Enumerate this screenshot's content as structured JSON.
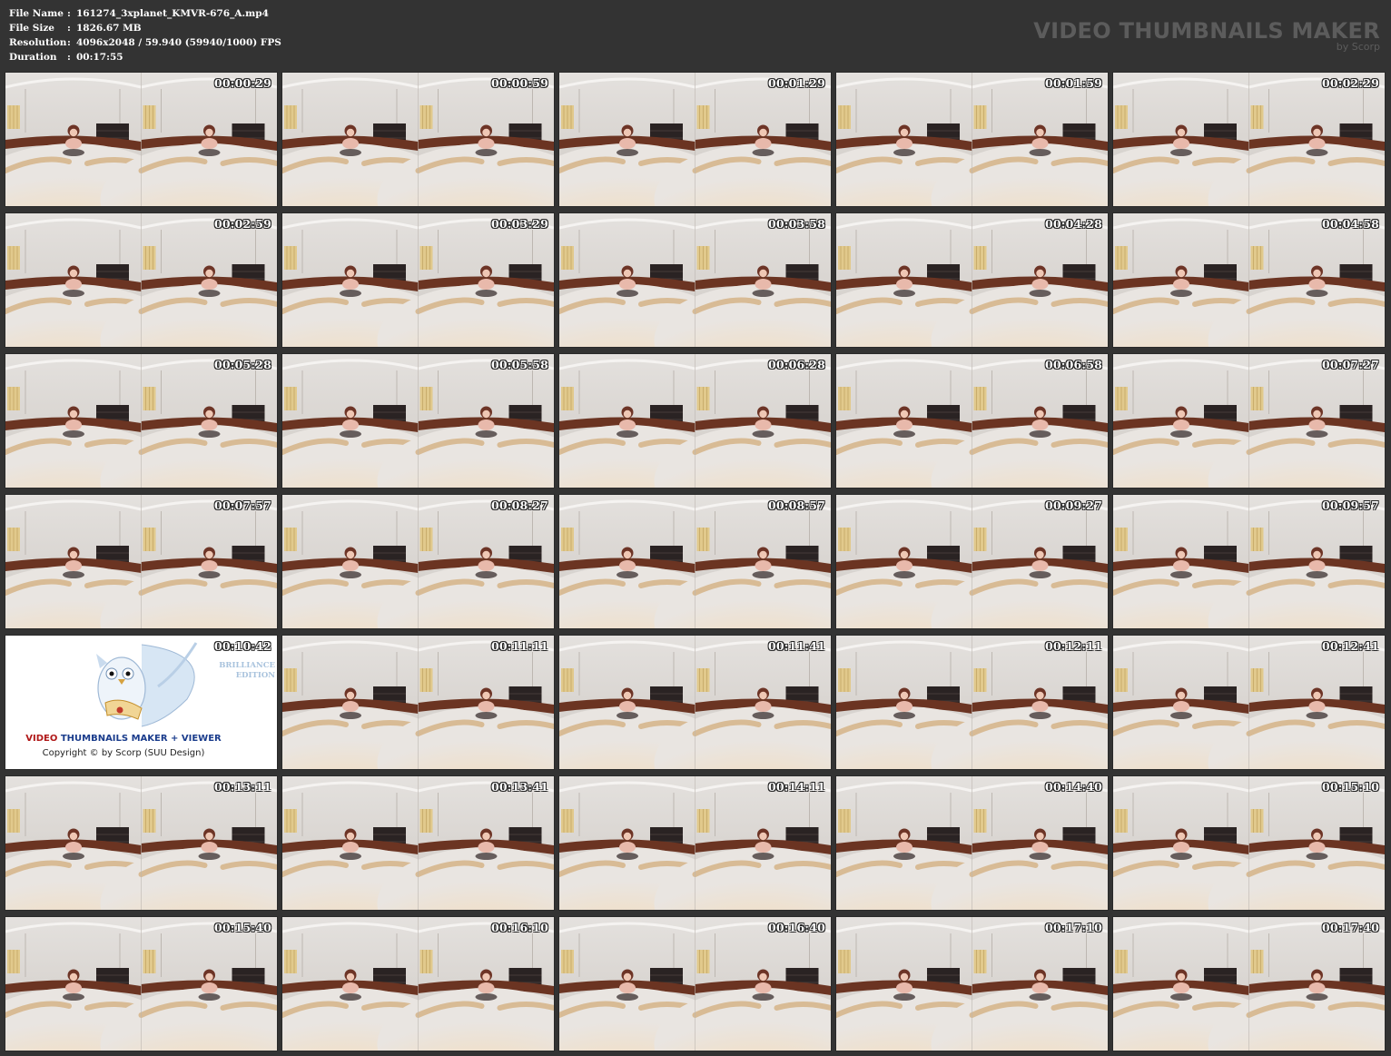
{
  "header": {
    "file_name_label": "File Name",
    "file_name": "161274_3xplanet_KMVR-676_A.mp4",
    "file_size_label": "File Size",
    "file_size": "1826.67 MB",
    "resolution_label": "Resolution",
    "resolution": "4096x2048 / 59.940 (59940/1000) FPS",
    "duration_label": "Duration",
    "duration": "00:17:55",
    "separator": ":"
  },
  "brand": {
    "title": "VIDEO THUMBNAILS MAKER",
    "subtitle": "by Scorp"
  },
  "logo": {
    "caption_red": "VIDEO",
    "caption_blue": "THUMBNAILS MAKER + VIEWER",
    "copyright": "Copyright © by Scorp (SUU Design)",
    "edition_line1": "BRILLIANCE",
    "edition_line2": "EDITION"
  },
  "thumbnails": [
    "00:00:29",
    "00:00:59",
    "00:01:29",
    "00:01:59",
    "00:02:29",
    "00:02:59",
    "00:03:29",
    "00:03:58",
    "00:04:28",
    "00:04:58",
    "00:05:28",
    "00:05:58",
    "00:06:28",
    "00:06:58",
    "00:07:27",
    "00:07:57",
    "00:08:27",
    "00:08:57",
    "00:09:27",
    "00:09:57",
    "00:10:42",
    "00:11:11",
    "00:11:41",
    "00:12:11",
    "00:12:41",
    "00:13:11",
    "00:13:41",
    "00:14:11",
    "00:14:40",
    "00:15:10",
    "00:15:40",
    "00:16:10",
    "00:16:40",
    "00:17:10",
    "00:17:40"
  ],
  "colors": {
    "background": "#333333",
    "text": "#ffffff",
    "brand": "#5c5c5c"
  }
}
